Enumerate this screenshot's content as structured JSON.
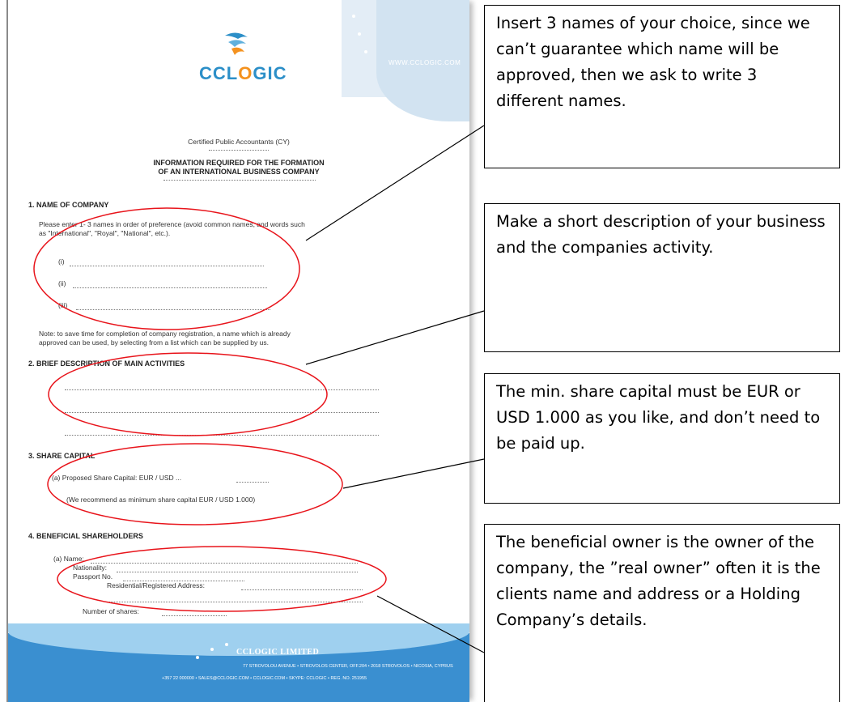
{
  "document": {
    "logo_text_cc": "CC",
    "logo_text_l": "L",
    "logo_text_o": "O",
    "logo_text_gic": "GIC",
    "site_url": "WWW.CCLOGIC.COM",
    "subtitle": "Certified Public Accountants (CY)",
    "heading_line1": "INFORMATION REQUIRED FOR THE FORMATION",
    "heading_line2": "OF AN INTERNATIONAL BUSINESS COMPANY",
    "section1_title": "1. NAME OF COMPANY",
    "section1_text_line1": "Please enter 1- 3 names in order of preference (avoid common names, and words such",
    "section1_text_line2": "as \"International\", \"Royal\", \"National\", etc.).",
    "name_i": "(i)",
    "name_ii": "(ii)",
    "name_iii": "(iii)",
    "note_line1": "Note: to save time for completion of company registration, a name which is already",
    "note_line2": "approved can be used, by selecting from a list which can be supplied by us.",
    "section2_title": "2. BRIEF DESCRIPTION OF MAIN ACTIVITIES",
    "section3_title": "3. SHARE CAPITAL",
    "share_capital_line": "(a) Proposed  Share Capital: EUR / USD ...",
    "share_capital_note": "(We recommend as minimum share capital EUR / USD 1.000)",
    "section4_title": "4. BENEFICIAL SHAREHOLDERS",
    "field_name": "(a) Name:",
    "field_nationality": "Nationality:",
    "field_passport": "Passport No.",
    "field_address": "Residential/Registered Address:",
    "field_shares": "Number of shares:",
    "footer_name": "CCLOGIC LIMITED",
    "footer_line1": "77 STROVOLOU AVENUE • STROVOLOS CENTER, OFF.204 • 2018 STROVOLOS • NICOSIA, CYPRUS",
    "footer_line2": "+357 22 000000 • SALES@CCLOGIC.COM • CCLOGIC.COM • SKYPE: CCLOGIC • REG. NO. 251955"
  },
  "callouts": [
    "Insert 3 names of your choice, since we can’t guarantee which name will be approved, then we ask to write 3 different names.",
    "Make a short description of your business and the companies activity.",
    "The min. share capital must be EUR or USD 1.000 as you like, and don’t need to be paid up.",
    "The beneficial owner is the owner of the company, the ”real owner” often it is the clients name and address or a Holding Company’s details."
  ],
  "colors": {
    "annotation_red": "#e8141b",
    "logo_blue": "#2c8fc8",
    "logo_orange": "#f4921f",
    "footer_blue": "#3a8fd0"
  }
}
